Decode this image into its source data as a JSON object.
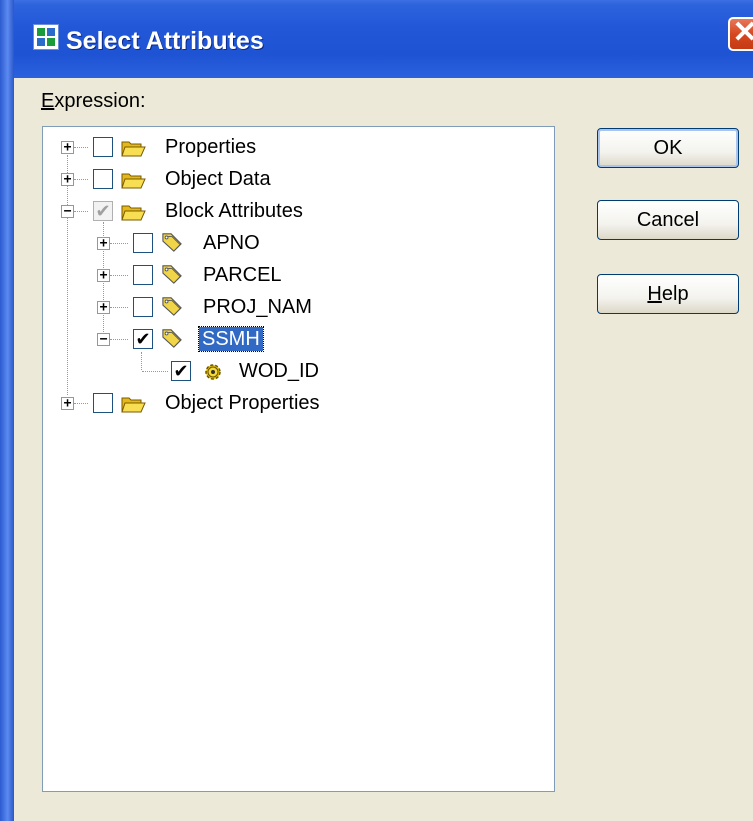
{
  "window": {
    "title": "Select Attributes",
    "close_glyph": "✕"
  },
  "dialog": {
    "expression_label": "Expression:",
    "buttons": {
      "ok": "OK",
      "cancel": "Cancel",
      "help": "Help"
    }
  },
  "tree": {
    "nodes": [
      {
        "label": "Properties",
        "expander": "+",
        "checked": false,
        "icon": "folder-icon"
      },
      {
        "label": "Object Data",
        "expander": "+",
        "checked": false,
        "icon": "folder-icon"
      },
      {
        "label": "Block Attributes",
        "expander": "−",
        "checked": "partial",
        "icon": "folder-icon"
      },
      {
        "label": "APNO",
        "expander": "+",
        "checked": false,
        "icon": "tag-icon"
      },
      {
        "label": "PARCEL",
        "expander": "+",
        "checked": false,
        "icon": "tag-icon"
      },
      {
        "label": "PROJ_NAM",
        "expander": "+",
        "checked": false,
        "icon": "tag-icon"
      },
      {
        "label": "SSMH",
        "expander": "−",
        "checked": true,
        "icon": "tag-icon",
        "selected": true
      },
      {
        "label": "WOD_ID",
        "expander": "",
        "checked": true,
        "icon": "gear-icon"
      },
      {
        "label": "Object Properties",
        "expander": "+",
        "checked": false,
        "icon": "folder-icon"
      }
    ],
    "check_glyph": "✔"
  },
  "colors": {
    "titlebar": "#2258d8",
    "dialog_bg": "#ece9d8",
    "selection": "#316ac5",
    "close": "#d6481f"
  }
}
